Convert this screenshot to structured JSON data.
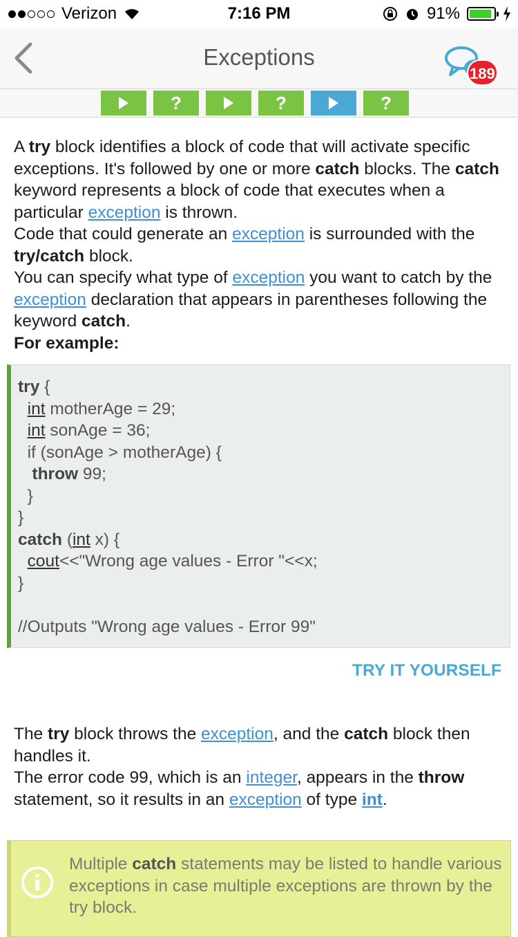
{
  "status": {
    "carrier": "Verizon",
    "time": "7:16 PM",
    "battery": "91%",
    "battery_level": 0.91
  },
  "nav": {
    "title": "Exceptions",
    "badge": "189"
  },
  "progress": {
    "steps": [
      {
        "type": "play",
        "state": "done"
      },
      {
        "type": "quiz",
        "label": "?",
        "state": "done"
      },
      {
        "type": "play",
        "state": "done"
      },
      {
        "type": "quiz",
        "label": "?",
        "state": "done"
      },
      {
        "type": "play",
        "state": "current"
      },
      {
        "type": "quiz",
        "label": "?",
        "state": "done"
      }
    ]
  },
  "intro": {
    "s1": "A ",
    "k1": "try",
    "s2": " block identifies a block of code that will activate specific exceptions. It's followed by one or more ",
    "k2": "catch",
    "s3": " blocks. The ",
    "k3": "catch",
    "s4": " keyword represents a block of code that executes when a particular ",
    "l1": "exception",
    "s5": " is thrown.",
    "s6": "Code that could generate an ",
    "l2": "exception",
    "s7": " is surrounded with the ",
    "k4": "try/catch",
    "s8": " block.",
    "s9": "You can specify what type of ",
    "l3": "exception",
    "s10": " you want to catch  by the ",
    "l4": "exception",
    "s11": " declaration that appears in parentheses following the keyword ",
    "k5": "catch",
    "s12": ".",
    "example": "For example:"
  },
  "code": {
    "try_kw": "try",
    "brace_open": " {",
    "int": "int",
    "l2": " motherAge = 29;",
    "l3": " sonAge = 36;",
    "l4": "  if (sonAge > motherAge) {",
    "throw_kw": "throw",
    "l5": " 99;",
    "l6": "  }",
    "l7": "}",
    "catch_kw": "catch",
    "l8a": " (",
    "l8b": " x) {",
    "cout": "cout",
    "l9": "<<\"Wrong age values - Error \"<<x;",
    "l10": "}",
    "comment": "//Outputs \"Wrong age values - Error 99\""
  },
  "try_button": "TRY IT YOURSELF",
  "explain": {
    "s1": "The ",
    "k1": "try",
    "s2": " block throws the ",
    "l1": "exception",
    "s3": ", and the ",
    "k2": "catch",
    "s4": " block then handles it.",
    "s5": "The error code 99, which is an ",
    "l2": "integer",
    "s6": ", appears in the ",
    "k3": "throw",
    "s7": " statement, so it results in an ",
    "l3": "exception",
    "s8": " of type ",
    "l4": "int",
    "s9": "."
  },
  "note": {
    "s1": "Multiple ",
    "k1": "catch",
    "s2": " statements may be listed to handle various exceptions in case multiple exceptions are thrown by the try block."
  }
}
